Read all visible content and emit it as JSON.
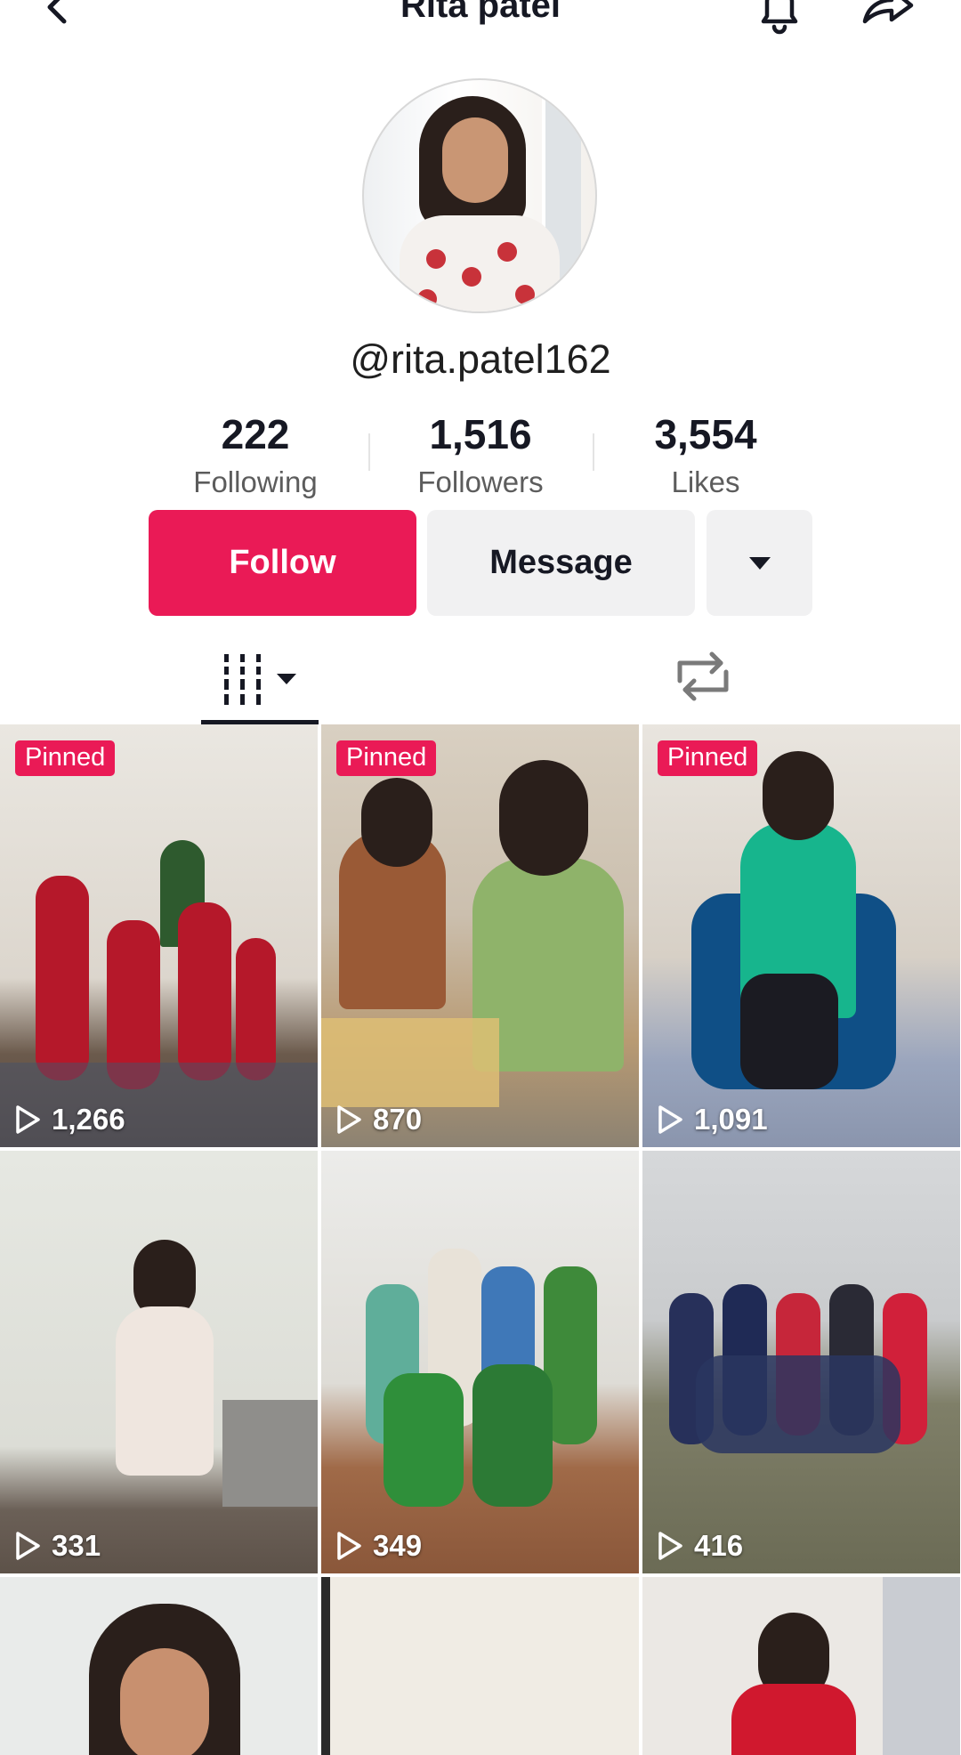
{
  "header": {
    "title": "Rita patel"
  },
  "profile": {
    "handle": "@rita.patel162"
  },
  "stats": [
    {
      "value": "222",
      "label": "Following"
    },
    {
      "value": "1,516",
      "label": "Followers"
    },
    {
      "value": "3,554",
      "label": "Likes"
    }
  ],
  "actions": {
    "follow": "Follow",
    "message": "Message"
  },
  "videos": [
    {
      "pinned": "Pinned",
      "views": "1,266"
    },
    {
      "pinned": "Pinned",
      "views": "870"
    },
    {
      "pinned": "Pinned",
      "views": "1,091"
    },
    {
      "views": "331"
    },
    {
      "views": "349"
    },
    {
      "views": "416"
    }
  ],
  "colors": {
    "accent": "#ea1a56",
    "button_gray": "#f1f1f2",
    "text": "#161823"
  },
  "icons": [
    "back-arrow-icon",
    "bell-icon",
    "share-icon",
    "chevron-down-icon",
    "videos-grid-icon",
    "repost-icon",
    "play-icon"
  ]
}
